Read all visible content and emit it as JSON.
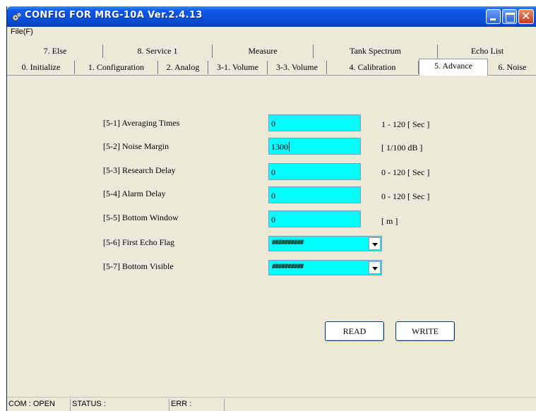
{
  "window": {
    "title": "CONFIG FOR MRG-10A Ver.2.4.13",
    "icon": "app-gear-icon"
  },
  "menu": {
    "file": "File(F)"
  },
  "tabs_top": [
    "7. Else",
    "8. Service 1",
    "Measure",
    "Tank Spectrum",
    "Echo List"
  ],
  "tabs_bottom": [
    "0. Initialize",
    "1. Configuration",
    "2. Analog",
    "3-1. Volume",
    "3-3. Volume",
    "4. Calibration",
    "5. Advance",
    "6. Noise"
  ],
  "active_tab": "5. Advance",
  "params": [
    {
      "label": "[5-1] Averaging Times",
      "value": "0",
      "unit": "1 - 120 [ Sec ]"
    },
    {
      "label": "[5-2] Noise Margin",
      "value": "1300",
      "unit": "[ 1/100 dB ]"
    },
    {
      "label": "[5-3] Research Delay",
      "value": "0",
      "unit": "0 - 120 [ Sec ]"
    },
    {
      "label": "[5-4] Alarm Delay",
      "value": "0",
      "unit": "0 - 120 [ Sec ]"
    },
    {
      "label": "[5-5] Bottom Window",
      "value": "0",
      "unit": "[ m ]"
    }
  ],
  "selects": [
    {
      "label": "[5-6] First Echo Flag",
      "value": "##########"
    },
    {
      "label": "[5-7] Bottom Visible",
      "value": "##########"
    }
  ],
  "buttons": {
    "read": "READ",
    "write": "WRITE"
  },
  "status": {
    "com": "COM : OPEN",
    "status": "STATUS :",
    "err": "ERR :"
  },
  "colors": {
    "input_bg": "#00ffff",
    "title_blue": "#0a4fd8",
    "window_face": "#ece9d8"
  }
}
